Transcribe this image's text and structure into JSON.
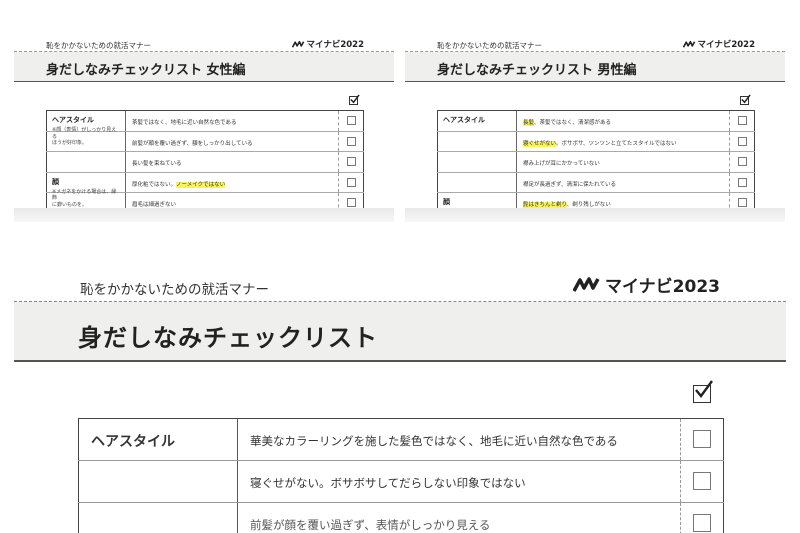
{
  "panel_left": {
    "manner": "恥をかかないための就活マナー",
    "brand_year": "マイナビ2022",
    "title": "身だしなみチェックリスト 女性編",
    "rows": [
      {
        "category": "ヘアスタイル",
        "note": "※顔（表情）がしっかり見える\nほうが好印象。",
        "item": "茶髪ではなく、地毛に近い自然な色である",
        "highlight": ""
      },
      {
        "category": "",
        "note": "",
        "item": "前髪が顔を覆い過ぎず、額をしっかり出している",
        "highlight": ""
      },
      {
        "category": "",
        "note": "",
        "item": "長い髪を束ねている",
        "highlight": ""
      },
      {
        "category": "顔",
        "note": "※メガネをかける場合は、縁飾\nに癖いものを。",
        "item": "厚化粧ではない。",
        "highlight": "ノーメイクではない"
      },
      {
        "category": "",
        "note": "",
        "item": "眉毛は細過ぎない",
        "highlight": ""
      }
    ]
  },
  "panel_right": {
    "manner": "恥をかかないための就活マナー",
    "brand_year": "マイナビ2022",
    "title": "身だしなみチェックリスト 男性編",
    "rows": [
      {
        "category": "ヘアスタイル",
        "highlight": "長髪",
        "item": "、茶髪ではなく、清潔感がある"
      },
      {
        "category": "",
        "highlight": "寝ぐせがない",
        "item": "。ボサボサ、ツンツンと立てたスタイルではない"
      },
      {
        "category": "",
        "highlight": "",
        "item": "襟み上げが耳にかかっていない"
      },
      {
        "category": "",
        "highlight": "",
        "item": "襟足が長過ぎず、清潔に保たれている"
      },
      {
        "category": "顔",
        "highlight": "髭はきちんと剃り",
        "item": "、剃り残しがない"
      }
    ]
  },
  "panel_main": {
    "manner": "恥をかかないための就活マナー",
    "brand_year": "マイナビ2023",
    "title": "身だしなみチェックリスト",
    "rows": [
      {
        "category": "ヘアスタイル",
        "item": "華美なカラーリングを施した髪色ではなく、地毛に近い自然な色である"
      },
      {
        "category": "",
        "item": "寝ぐせがない。ボサボサしてだらしない印象ではない"
      },
      {
        "category": "",
        "item": "前髪が顔を覆い過ぎず、表情がしっかり見える"
      }
    ]
  },
  "colors": {
    "highlight": "#fbf35b",
    "titlebar": "#efefed"
  },
  "icons": {
    "logo": "mynavi-logo-icon",
    "check": "checkmark-icon",
    "box": "checkbox-icon"
  }
}
